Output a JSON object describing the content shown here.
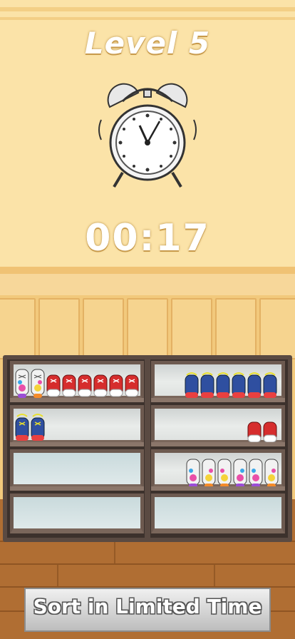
{
  "header": {
    "level_label": "Level 5"
  },
  "timer": {
    "value": "00:17"
  },
  "banner": {
    "text": "Sort in Limited Time"
  },
  "shelves": {
    "left": [
      {
        "row": 1,
        "shoes": [
          "colorful-sneaker",
          "colorful-sneaker",
          "red-sneaker",
          "red-sneaker",
          "red-sneaker"
        ]
      },
      {
        "row": 2,
        "shoes": [
          "blue-sneaker"
        ]
      },
      {
        "row": 3,
        "shoes": []
      },
      {
        "row": 4,
        "shoes": []
      }
    ],
    "right": [
      {
        "row": 1,
        "shoes": [
          "blue-sneaker",
          "blue-sneaker",
          "blue-sneaker",
          "blue-sneaker",
          "blue-sneaker"
        ]
      },
      {
        "row": 2,
        "shoes": [
          "red-sneaker"
        ]
      },
      {
        "row": 3,
        "shoes": [
          "colorful-sneaker",
          "colorful-sneaker",
          "colorful-sneaker",
          "colorful-sneaker",
          "colorful-sneaker"
        ]
      },
      {
        "row": 4,
        "shoes": []
      }
    ]
  },
  "colors": {
    "wall": "#fbe3a8",
    "floor": "#b06e33",
    "cabinet": "#5a4a42",
    "red_shoe": "#d62d2d",
    "blue_shoe": "#2f4fa0",
    "lace_yellow": "#e9e02a"
  }
}
